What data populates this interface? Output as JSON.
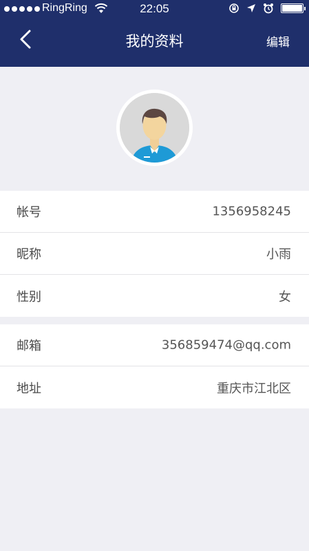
{
  "status_bar": {
    "carrier": "RingRing",
    "time": "22:05"
  },
  "nav": {
    "title": "我的资料",
    "edit_label": "编辑",
    "bar_color": "#1f2f6b"
  },
  "profile": {
    "groups": [
      {
        "rows": [
          {
            "label": "帐号",
            "value": "1356958245"
          },
          {
            "label": "昵称",
            "value": "小雨"
          },
          {
            "label": "性别",
            "value": "女"
          }
        ]
      },
      {
        "rows": [
          {
            "label": "邮箱",
            "value": "356859474@qq.com"
          },
          {
            "label": "地址",
            "value": "重庆市江北区"
          }
        ]
      }
    ]
  }
}
